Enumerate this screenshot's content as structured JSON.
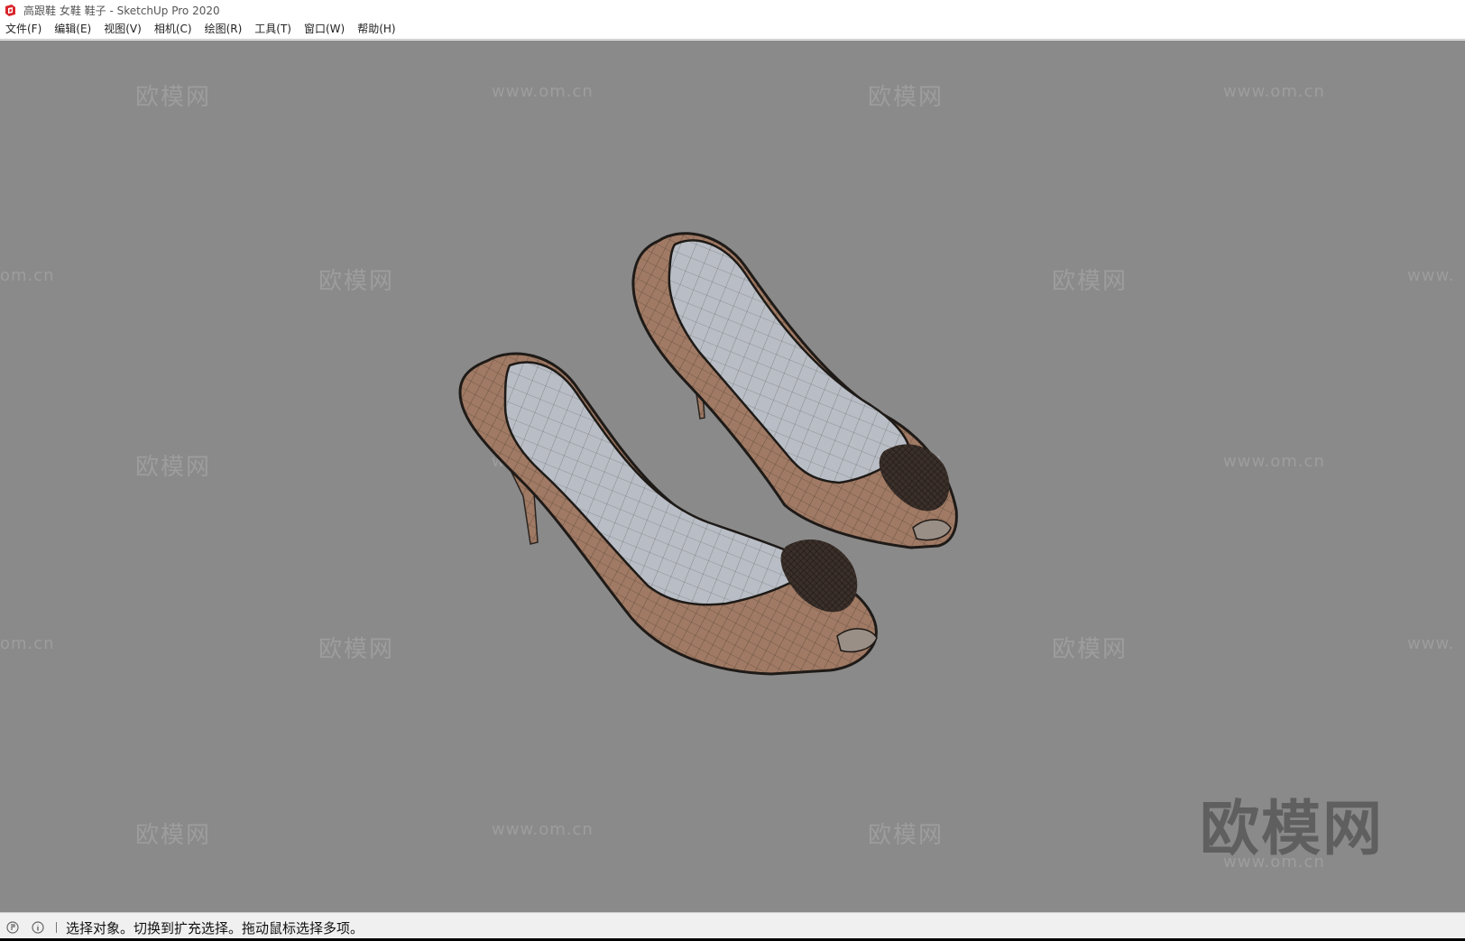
{
  "window": {
    "title": "高跟鞋 女鞋 鞋子 - SketchUp Pro 2020",
    "app_icon": "sketchup-logo-icon"
  },
  "menu": {
    "items": [
      {
        "label": "文件(F)"
      },
      {
        "label": "编辑(E)"
      },
      {
        "label": "视图(V)"
      },
      {
        "label": "相机(C)"
      },
      {
        "label": "绘图(R)"
      },
      {
        "label": "工具(T)"
      },
      {
        "label": "窗口(W)"
      },
      {
        "label": "帮助(H)"
      }
    ]
  },
  "viewport": {
    "background_color": "#8a8a8a",
    "watermark_cn": "欧模网",
    "watermark_url": "www.om.cn",
    "watermark_url_partial_left": "om.cn",
    "watermark_url_partial_right": "www.",
    "model_colors": {
      "leather": "#a07a64",
      "lining": "#b9bec6",
      "wire": "#2b2420"
    }
  },
  "statusbar": {
    "icons": [
      "geo-location-icon",
      "info-icon"
    ],
    "text": "选择对象。切换到扩充选择。拖动鼠标选择多项。"
  }
}
